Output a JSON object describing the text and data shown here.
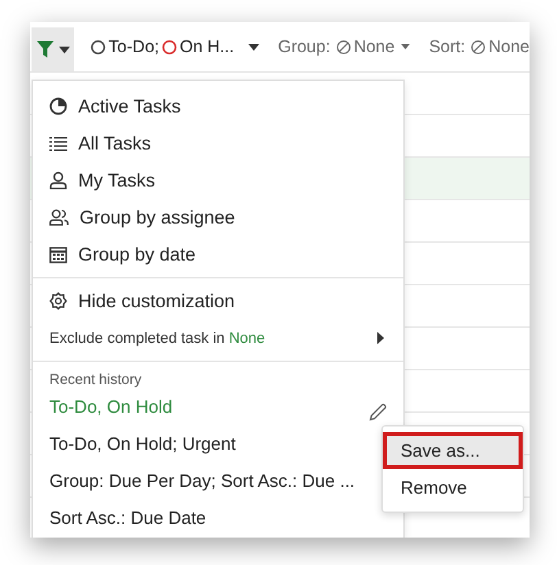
{
  "toolbar": {
    "filter_button": {
      "expanded": true
    },
    "status_filter": [
      {
        "label": "To-Do;",
        "color": "#444444"
      },
      {
        "label": "On H...",
        "color": "#d92b2b"
      }
    ],
    "group": {
      "label": "Group:",
      "value": "None"
    },
    "sort": {
      "label": "Sort:",
      "value": "None"
    }
  },
  "background_rows": [
    {
      "selected": false
    },
    {
      "selected": false
    },
    {
      "selected": true
    },
    {
      "selected": false
    },
    {
      "selected": false
    },
    {
      "selected": false
    },
    {
      "selected": false
    },
    {
      "selected": false
    },
    {
      "selected": false
    },
    {
      "selected": false
    }
  ],
  "menu": {
    "views": [
      {
        "kind": "pie",
        "label": "Active Tasks"
      },
      {
        "kind": "list",
        "label": "All Tasks"
      },
      {
        "kind": "person",
        "label": "My Tasks"
      },
      {
        "kind": "people",
        "label": "Group by assignee"
      },
      {
        "kind": "calendar",
        "label": "Group by date"
      }
    ],
    "hide_customization": "Hide customization",
    "exclude": {
      "text": "Exclude completed task in",
      "value": "None"
    },
    "recent_history": {
      "title": "Recent history",
      "items": [
        {
          "label": "To-Do, On Hold",
          "selected": true
        },
        {
          "label": "To-Do, On Hold; Urgent",
          "selected": false
        },
        {
          "label": "Group: Due Per Day; Sort Asc.: Due ...",
          "selected": false
        },
        {
          "label": "Sort Asc.: Due Date",
          "selected": false
        }
      ]
    }
  },
  "context_menu": {
    "items": [
      {
        "label": "Save as...",
        "selected": true
      },
      {
        "label": "Remove",
        "selected": false
      }
    ]
  }
}
